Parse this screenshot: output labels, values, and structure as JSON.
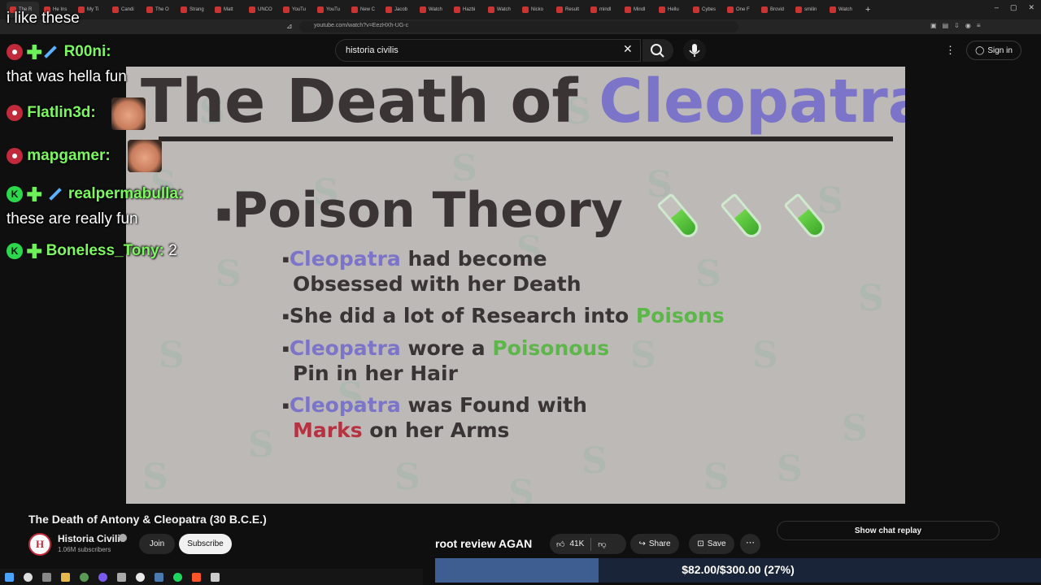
{
  "browser": {
    "tabs": [
      "The R",
      "He Ins",
      "My Ti",
      "Candi",
      "The O",
      "Strang",
      "Matt",
      "UNCO",
      "YouTu",
      "YouTu",
      "New C",
      "Jacob",
      "Watch",
      "Hazbi",
      "Watch",
      "Nicko",
      "Result",
      "mindl",
      "Mindl",
      "Hellu",
      "Cybes",
      "One F",
      "Brovid",
      "smilin",
      "Watch"
    ],
    "new_tab": "+",
    "url": "youtube.com/watch?v=EezHXh-UG-c",
    "window_controls": [
      "–",
      "▢",
      "✕"
    ]
  },
  "youtube": {
    "search_value": "historia civilis",
    "signin_label": "Sign in"
  },
  "slide": {
    "title_part1": "The Death of ",
    "title_part2": "Cleopatra",
    "heading": "Poison Theory",
    "points": [
      {
        "parts": [
          {
            "t": "Cleopatra",
            "c": "purple"
          },
          {
            "t": " had become",
            "c": ""
          }
        ],
        "line2": [
          {
            "t": "Obsessed with her Death",
            "c": ""
          }
        ]
      },
      {
        "parts": [
          {
            "t": "She did a lot of Research into ",
            "c": ""
          },
          {
            "t": "Poisons",
            "c": "green"
          }
        ],
        "line2": []
      },
      {
        "parts": [
          {
            "t": "Cleopatra",
            "c": "purple"
          },
          {
            "t": " wore a ",
            "c": ""
          },
          {
            "t": "Poisonous",
            "c": "green"
          }
        ],
        "line2": [
          {
            "t": "Pin in her Hair",
            "c": ""
          }
        ]
      },
      {
        "parts": [
          {
            "t": "Cleopatra",
            "c": "purple"
          },
          {
            "t": " was Found with",
            "c": ""
          }
        ],
        "line2": [
          {
            "t": "Marks",
            "c": "red"
          },
          {
            "t": " on her Arms",
            "c": ""
          }
        ]
      }
    ]
  },
  "chat": {
    "top_message": "i like these",
    "user1": "R00ni:",
    "msg1": "that was hella fun",
    "user2": "Flatlin3d:",
    "user3": "mapgamer:",
    "user4": "realpermabulla:",
    "msg4": "these are really fun",
    "user5": "Boneless_Tony:",
    "msg5": "2"
  },
  "video_info": {
    "title": "The Death of Antony & Cleopatra (30 B.C.E.)",
    "channel_initial": "H",
    "channel": "Historia Civilis",
    "subscribers": "1.06M subscribers",
    "join_label": "Join",
    "subscribe_label": "Subscribe",
    "likes": "41K",
    "share_label": "Share",
    "save_label": "Save",
    "chat_replay_label": "Show chat replay"
  },
  "stream": {
    "title": "root review AGAN",
    "goal_text": "$82.00/$300.00 (27%)",
    "goal_fraction": 0.27
  },
  "colors": {
    "accent_purple": "#7b74c9",
    "accent_green": "#5db64a",
    "accent_red": "#b73241",
    "chat_name": "#7cf760"
  }
}
